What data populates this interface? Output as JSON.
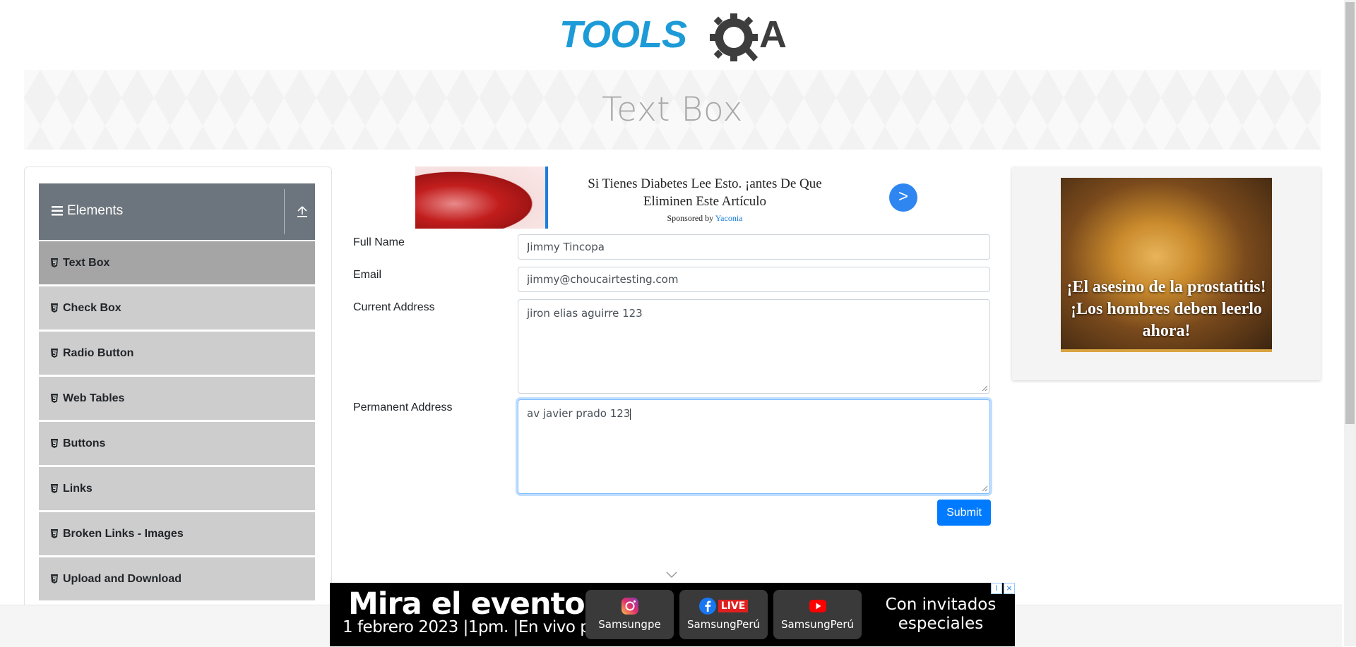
{
  "header": {
    "logo": {
      "brand_left": "TOOLS",
      "brand_right": "A",
      "icon": "gear-q-logo-icon"
    },
    "page_title": "Text Box"
  },
  "sidebar": {
    "group": {
      "label": "Elements",
      "icon": "hamburger-icon",
      "collapse_icon": "collapse-up-icon"
    },
    "items": [
      {
        "label": "Text Box",
        "active": true,
        "icon": "html5-icon"
      },
      {
        "label": "Check Box",
        "active": false,
        "icon": "html5-icon"
      },
      {
        "label": "Radio Button",
        "active": false,
        "icon": "html5-icon"
      },
      {
        "label": "Web Tables",
        "active": false,
        "icon": "html5-icon"
      },
      {
        "label": "Buttons",
        "active": false,
        "icon": "html5-icon"
      },
      {
        "label": "Links",
        "active": false,
        "icon": "html5-icon"
      },
      {
        "label": "Broken Links - Images",
        "active": false,
        "icon": "html5-icon"
      },
      {
        "label": "Upload and Download",
        "active": false,
        "icon": "html5-icon"
      }
    ]
  },
  "ad_top": {
    "headline": "Si Tienes Diabetes Lee Esto. ¡antes De Que Eliminen Este Artículo",
    "sponsor_prefix": "Sponsored by",
    "sponsor_brand": "Yaconia",
    "button": ">"
  },
  "form": {
    "full_name": {
      "label": "Full Name",
      "value": "Jimmy Tincopa"
    },
    "email": {
      "label": "Email",
      "value": "jimmy@choucairtesting.com"
    },
    "current_address": {
      "label": "Current Address",
      "value": "jiron elias aguirre 123"
    },
    "permanent_address": {
      "label": "Permanent Address",
      "value": "av javier prado 123"
    },
    "submit_label": "Submit"
  },
  "ad_right": {
    "caption": "¡El asesino de la prostatitis! ¡Los hombres deben leerlo ahora!"
  },
  "ad_bottom": {
    "title": "Mira el evento",
    "subtitle_date": "1 febrero 2023",
    "subtitle_time": "1pm.",
    "subtitle_tail": "En vivo por:",
    "socials": [
      {
        "name": "Samsungpe",
        "icon": "instagram-icon"
      },
      {
        "name": "SamsungPerú",
        "icon": "facebook-live-icon",
        "badge": "LIVE"
      },
      {
        "name": "SamsungPerú",
        "icon": "youtube-icon"
      }
    ],
    "extra": "Con invitados especiales"
  },
  "colors": {
    "primary": "#007bff",
    "sidebar_header": "#6c757d",
    "menu_item": "#cdcdcd",
    "menu_item_active": "#a5a5a5",
    "logo_blue": "#1d9bd7",
    "logo_dark": "#3d3d3d"
  }
}
